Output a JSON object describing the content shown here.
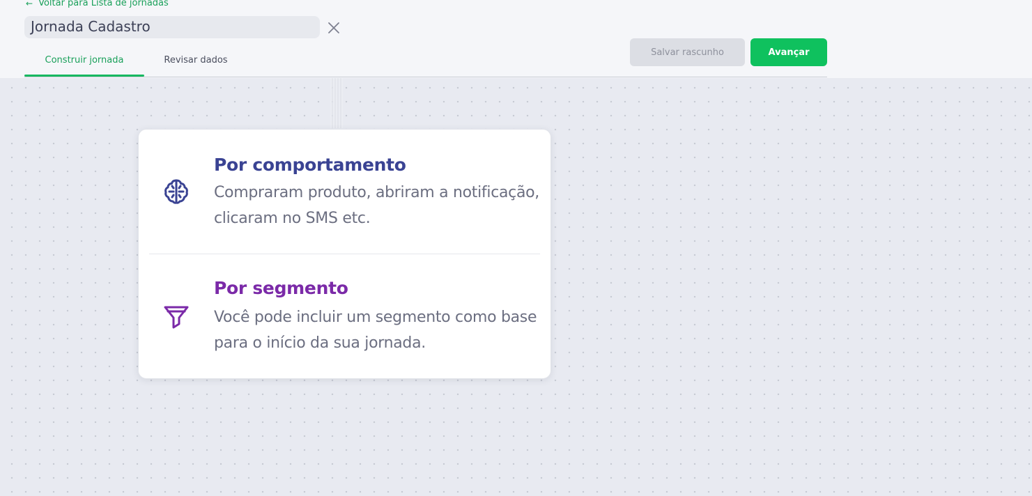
{
  "header": {
    "back_link": "Voltar para Lista de jornadas",
    "journey_name": "Jornada Cadastro",
    "tabs": [
      {
        "label": "Construir jornada",
        "active": true
      },
      {
        "label": "Revisar dados",
        "active": false
      }
    ],
    "save_draft_label": "Salvar rascunho",
    "next_label": "Avançar"
  },
  "options": [
    {
      "title": "Por comportamento",
      "description": "Compraram produto, abriram a notificação, clicaram no SMS etc.",
      "icon": "brain-icon",
      "color": "#3a4393"
    },
    {
      "title": "Por segmento",
      "description": "Você pode incluir um segmento como base para o início da sua jornada.",
      "icon": "filter-icon",
      "color": "#7b2aa8"
    }
  ],
  "colors": {
    "accent": "#0fc15e",
    "tab_active": "#1aa05a"
  }
}
